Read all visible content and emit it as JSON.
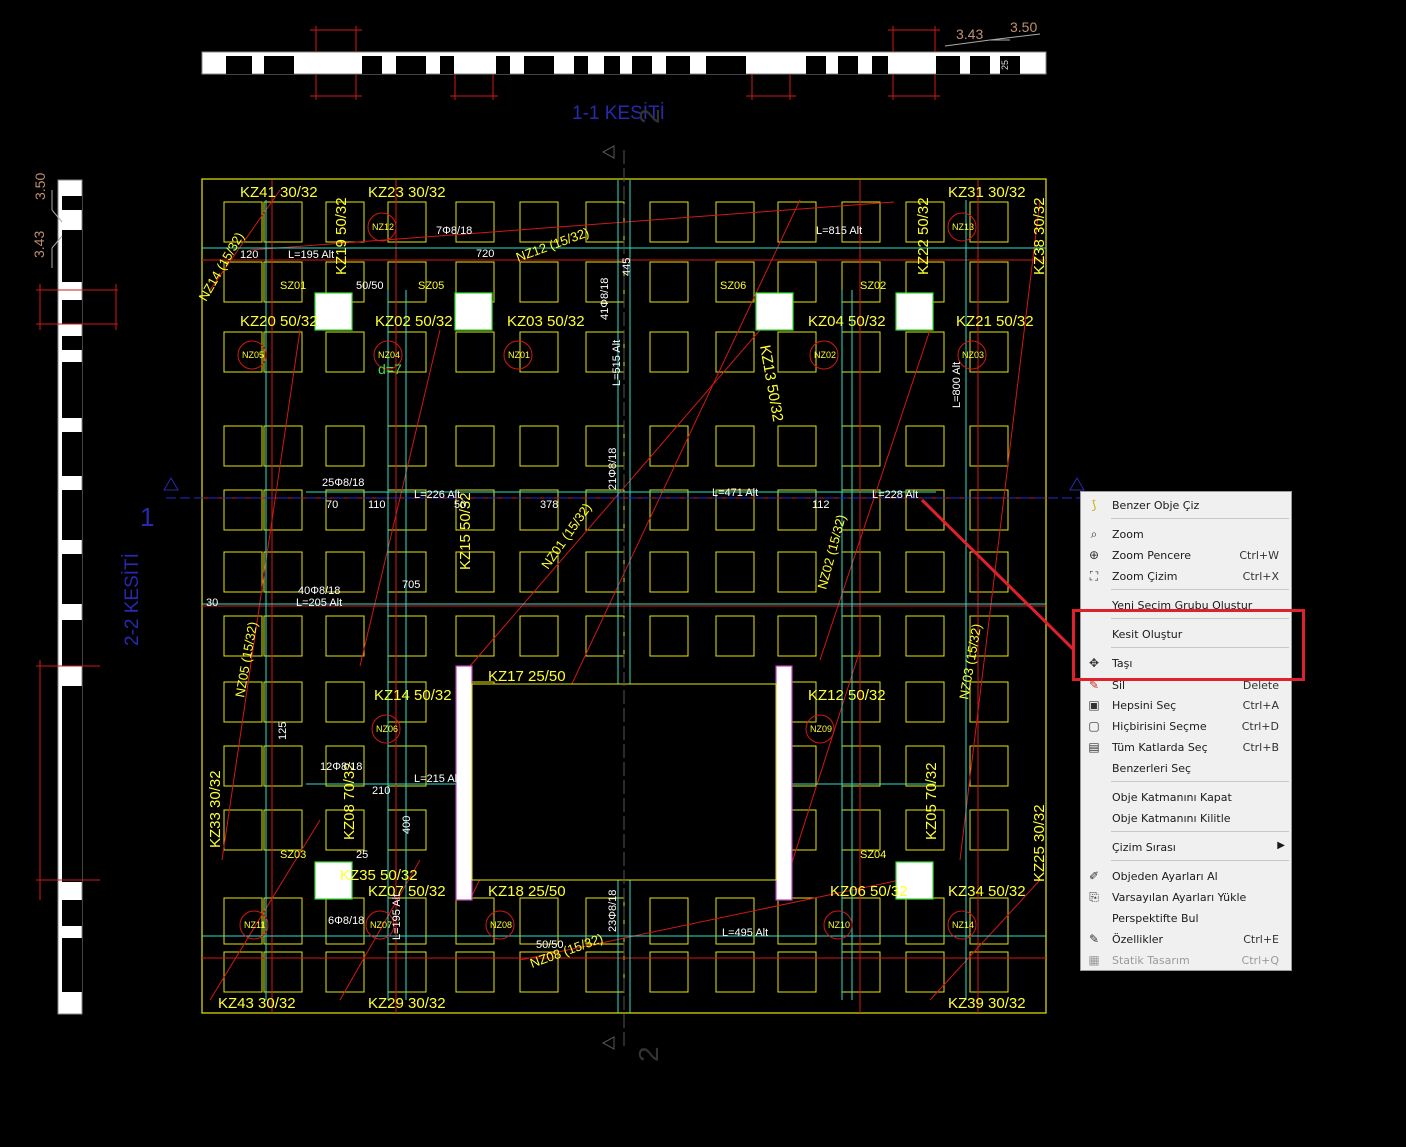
{
  "colors": {
    "background": "#000000",
    "grid": "#e6e60a",
    "axis_red": "#d01818",
    "rebar_cyan": "#30e0c8",
    "section_blue": "#2828b0",
    "label_yellow": "#ffff30",
    "highlight_red": "#e0202a"
  },
  "section_titles": {
    "section_1_1": "1-1 KESİTİ",
    "section_2_2": "2-2 KESİTİ",
    "axis_1": "1",
    "axis_2_top": "2",
    "axis_2_bottom": "2"
  },
  "elevations": {
    "top_a": "3.43",
    "top_b": "3.50",
    "left_a": "3.50",
    "left_b": "3.43",
    "dim_25": "25"
  },
  "beams": [
    "KZ41 30/32",
    "KZ23 30/32",
    "KZ31 30/32",
    "KZ20 50/32",
    "KZ02 50/32",
    "KZ03 50/32",
    "KZ04 50/32",
    "KZ21 50/32",
    "KZ13 50/32",
    "KZ15 50/32",
    "KZ17 25/50",
    "KZ14 50/32",
    "KZ12 50/32",
    "KZ18 25/50",
    "KZ08 70/32",
    "KZ05 70/32",
    "KZ33 30/32",
    "KZ25 30/32",
    "KZ43 30/32",
    "KZ29 30/32",
    "KZ39 30/32",
    "KZ35 50/32",
    "KZ06 50/32",
    "KZ34 50/32",
    "KZ07 50/32",
    "KZ38 30/32",
    "KZ19 50/32",
    "KZ22 50/32"
  ],
  "slab_tags": [
    "NZ12",
    "NZ13",
    "NZ05",
    "NZ04",
    "NZ01",
    "NZ02",
    "NZ03",
    "NZ06",
    "NZ09",
    "NZ11",
    "NZ07",
    "NZ08",
    "NZ10",
    "NZ14"
  ],
  "panel_labels": [
    "SZ01",
    "SZ05",
    "SZ06",
    "SZ02",
    "SZ03",
    "SZ04"
  ],
  "rebar_labels": [
    "7Φ8/18",
    "25Φ8/18",
    "40Φ8/18",
    "12Φ8/18",
    "6Φ8/18",
    "21Φ8/18",
    "41Φ8/18",
    "23Φ8/18",
    "L=815 Alt",
    "L=195 Alt",
    "L=226 Alt",
    "L=471 Alt",
    "L=228 Alt",
    "L=205 Alt",
    "L=215 Alt",
    "L=495 Alt",
    "L=800 Alt",
    "L=515 Alt",
    "L=195 Alt",
    "d=7",
    "NZ12 (15/32)",
    "NZ01 (15/32)",
    "NZ08 (15/32)",
    "NZ05 (15/32)",
    "NZ03 (15/32)",
    "NZ02 (15/32)",
    "NZ14 (15/32)"
  ],
  "dimensions": [
    "720",
    "50/50",
    "70",
    "110",
    "50",
    "378",
    "112",
    "30",
    "120",
    "445",
    "705",
    "125",
    "210",
    "400",
    "50/50",
    "25"
  ],
  "context_menu": {
    "items": [
      {
        "label": "Benzer Obje Çiz",
        "shortcut": "",
        "icon": "similar-object-icon"
      },
      {
        "label": "Zoom",
        "shortcut": "",
        "icon": "zoom-icon"
      },
      {
        "label": "Zoom Pencere",
        "shortcut": "Ctrl+W",
        "icon": "zoom-window-icon"
      },
      {
        "label": "Zoom Çizim",
        "shortcut": "Ctrl+X",
        "icon": "zoom-drawing-icon"
      },
      {
        "label": "Yeni Seçim Grubu Oluştur",
        "shortcut": "",
        "icon": ""
      },
      {
        "label": "Kesit Oluştur",
        "shortcut": "",
        "icon": ""
      },
      {
        "label": "Taşı",
        "shortcut": "",
        "icon": "move-icon"
      },
      {
        "label": "Sil",
        "shortcut": "Delete",
        "icon": "erase-icon"
      },
      {
        "label": "Hepsini Seç",
        "shortcut": "Ctrl+A",
        "icon": "select-all-icon"
      },
      {
        "label": "Hiçbirisini Seçme",
        "shortcut": "Ctrl+D",
        "icon": "select-none-icon"
      },
      {
        "label": "Tüm Katlarda Seç",
        "shortcut": "Ctrl+B",
        "icon": "select-all-floors-icon"
      },
      {
        "label": "Benzerleri Seç",
        "shortcut": "",
        "icon": ""
      },
      {
        "label": "Obje Katmanını Kapat",
        "shortcut": "",
        "icon": ""
      },
      {
        "label": "Obje Katmanını Kilitle",
        "shortcut": "",
        "icon": ""
      },
      {
        "label": "Çizim Sırası",
        "shortcut": "",
        "icon": "",
        "submenu": true
      },
      {
        "label": "Objeden Ayarları Al",
        "shortcut": "",
        "icon": "eyedropper-icon"
      },
      {
        "label": "Varsayılan Ayarları Yükle",
        "shortcut": "",
        "icon": "load-defaults-icon"
      },
      {
        "label": "Perspektifte Bul",
        "shortcut": "",
        "icon": ""
      },
      {
        "label": "Özellikler",
        "shortcut": "Ctrl+E",
        "icon": "properties-icon"
      },
      {
        "label": "Statik Tasarım",
        "shortcut": "Ctrl+Q",
        "icon": "static-design-icon",
        "disabled": true
      }
    ]
  }
}
